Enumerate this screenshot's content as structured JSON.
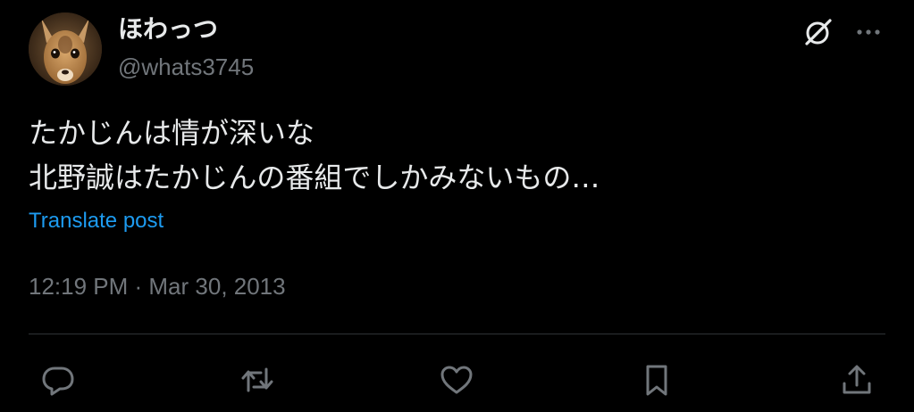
{
  "user": {
    "display_name": "ほわっつ",
    "handle": "@whats3745"
  },
  "post": {
    "lines": [
      "たかじんは情が深いな",
      "北野誠はたかじんの番組でしかみないもの…"
    ],
    "translate_label": "Translate post",
    "timestamp": "12:19 PM · Mar 30, 2013"
  },
  "icons": {
    "grok": "grok-icon",
    "more": "more-icon",
    "reply": "reply-icon",
    "repost": "repost-icon",
    "like": "like-icon",
    "bookmark": "bookmark-icon",
    "share": "share-icon"
  },
  "colors": {
    "background": "#000000",
    "text": "#e7e9ea",
    "muted": "#71767b",
    "link": "#1d9bf0",
    "divider": "#2f3336"
  }
}
